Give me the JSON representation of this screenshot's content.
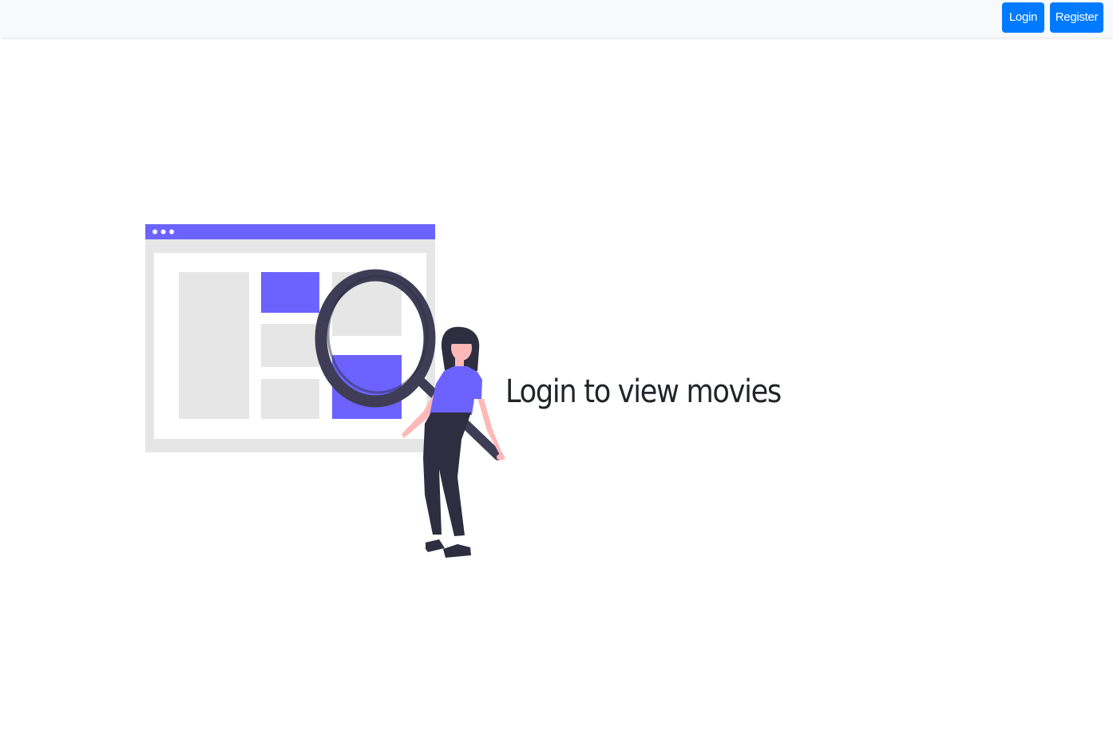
{
  "navbar": {
    "login_label": "Login",
    "register_label": "Register",
    "button_color": "#007bff"
  },
  "main": {
    "headline": "Login to view movies",
    "illustration": {
      "icon": "woman-with-magnifying-glass-browser-illustration",
      "accent_color": "#6c63ff",
      "dark_color": "#3f3d56",
      "placeholder_color": "#e6e6e6"
    }
  }
}
